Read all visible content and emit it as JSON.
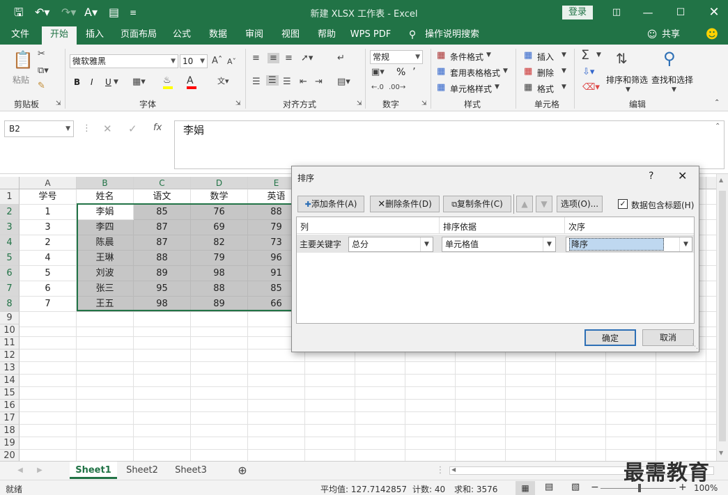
{
  "window": {
    "title": "新建 XLSX 工作表  -  Excel",
    "login_label": "登录",
    "share_label": "共享"
  },
  "tabs": [
    "文件",
    "开始",
    "插入",
    "页面布局",
    "公式",
    "数据",
    "审阅",
    "视图",
    "帮助",
    "WPS PDF",
    "操作说明搜索"
  ],
  "ribbon": {
    "clipboard": {
      "paste_label": "粘贴",
      "group_label": "剪贴板"
    },
    "font": {
      "font_name": "微软雅黑",
      "font_size": "10",
      "bold": "B",
      "italic": "I",
      "underline": "U",
      "group_label": "字体"
    },
    "alignment": {
      "group_label": "对齐方式"
    },
    "number": {
      "format": "常规",
      "percent": "%",
      "group_label": "数字"
    },
    "styles": {
      "conditional_format": "条件格式",
      "table_format": "套用表格格式",
      "cell_style": "单元格样式",
      "group_label": "样式"
    },
    "cells": {
      "insert": "插入",
      "delete": "删除",
      "format": "格式",
      "group_label": "单元格"
    },
    "editing": {
      "sort_filter": "排序和筛选",
      "find_select": "查找和选择",
      "group_label": "编辑"
    }
  },
  "formula_bar": {
    "name_box": "B2",
    "content": "李娟",
    "fx": "fx"
  },
  "sheet": {
    "columns": [
      "A",
      "B",
      "C",
      "D",
      "E"
    ],
    "rows": [
      "1",
      "2",
      "3",
      "4",
      "5",
      "6",
      "7",
      "8",
      "9",
      "10",
      "11",
      "12",
      "13",
      "14",
      "15",
      "16",
      "17",
      "18",
      "19",
      "20"
    ],
    "header": [
      "学号",
      "姓名",
      "语文",
      "数学",
      "英语"
    ],
    "data": [
      [
        "1",
        "李娟",
        "85",
        "76",
        "88"
      ],
      [
        "3",
        "李四",
        "87",
        "69",
        "79"
      ],
      [
        "2",
        "陈晨",
        "87",
        "82",
        "73"
      ],
      [
        "4",
        "王琳",
        "88",
        "79",
        "96"
      ],
      [
        "5",
        "刘波",
        "89",
        "98",
        "91"
      ],
      [
        "6",
        "张三",
        "95",
        "88",
        "85"
      ],
      [
        "7",
        "王五",
        "98",
        "89",
        "66"
      ]
    ]
  },
  "sheet_tabs": [
    "Sheet1",
    "Sheet2",
    "Sheet3"
  ],
  "status": {
    "ready": "就绪",
    "average": "平均值: 127.7142857",
    "count": "计数: 40",
    "sum": "求和: 3576",
    "zoom": "100%"
  },
  "dialog": {
    "title": "排序",
    "help": "?",
    "add_condition": "添加条件(A)",
    "delete_condition": "删除条件(D)",
    "copy_condition": "复制条件(C)",
    "options": "选项(O)...",
    "has_headers": "数据包含标题(H)",
    "col_header": "列",
    "sort_on_header": "排序依据",
    "order_header": "次序",
    "primary_key_label": "主要关键字",
    "column_value": "总分",
    "sort_on_value": "单元格值",
    "order_value": "降序",
    "ok": "确定",
    "cancel": "取消"
  },
  "watermark": "最需教育"
}
